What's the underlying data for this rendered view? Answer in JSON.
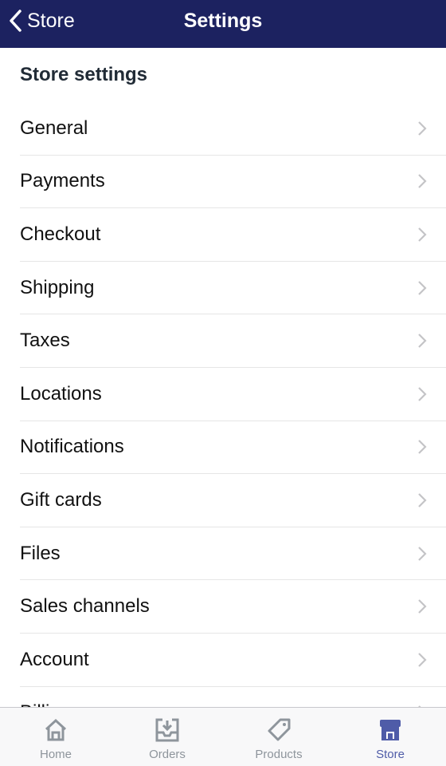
{
  "header": {
    "back_label": "Store",
    "title": "Settings"
  },
  "section_title": "Store settings",
  "items": [
    {
      "label": "General"
    },
    {
      "label": "Payments"
    },
    {
      "label": "Checkout"
    },
    {
      "label": "Shipping"
    },
    {
      "label": "Taxes"
    },
    {
      "label": "Locations"
    },
    {
      "label": "Notifications"
    },
    {
      "label": "Gift cards"
    },
    {
      "label": "Files"
    },
    {
      "label": "Sales channels"
    },
    {
      "label": "Account"
    },
    {
      "label": "Billing"
    }
  ],
  "tabs": [
    {
      "label": "Home",
      "icon": "home-icon"
    },
    {
      "label": "Orders",
      "icon": "inbox-download-icon"
    },
    {
      "label": "Products",
      "icon": "tag-icon"
    },
    {
      "label": "Store",
      "icon": "storefront-icon",
      "active": true
    }
  ],
  "colors": {
    "nav_bg": "#1c2260",
    "active_tab": "#4f5ca8",
    "inactive_tab": "#8e959c"
  }
}
